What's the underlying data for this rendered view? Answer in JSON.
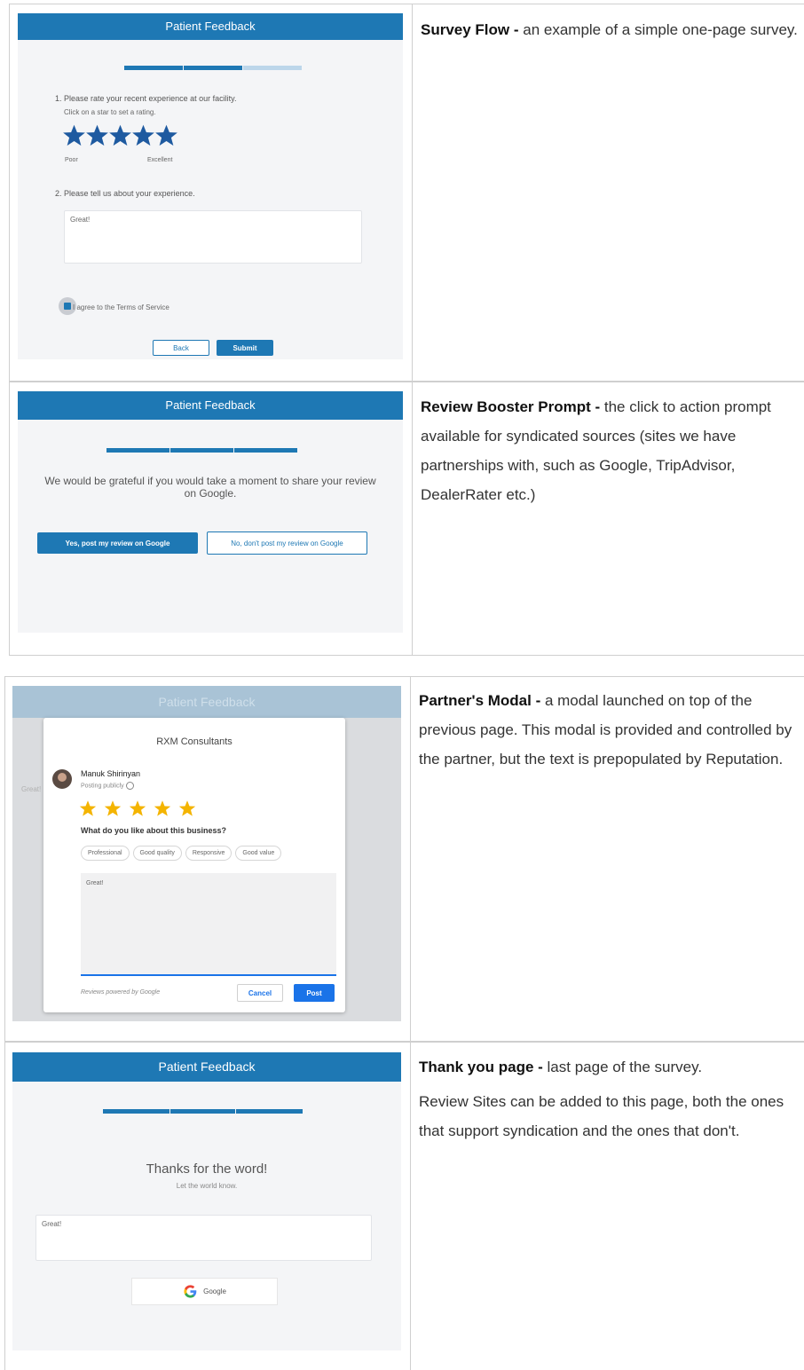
{
  "rows": [
    {
      "title": "Survey Flow - ",
      "text": "an example of a simple one-page survey.",
      "shot": {
        "header": "Patient Feedback",
        "q1": "1. Please rate your recent experience at our facility.",
        "q1_hint": "Click on a star to set a rating.",
        "rating": 5,
        "low_label": "Poor",
        "high_label": "Excellent",
        "q2": "2. Please tell us about your experience.",
        "answer": "Great!",
        "terms": "I agree to the Terms of Service",
        "back": "Back",
        "submit": "Submit"
      }
    },
    {
      "title": "Review Booster Prompt - ",
      "text": "the click to action prompt available for syndicated sources (sites we have partnerships with, such as Google, TripAdvisor, DealerRater etc.)",
      "shot": {
        "header": "Patient Feedback",
        "message": "We would be grateful if you would take a moment to share your review on Google.",
        "yes": "Yes, post my review on Google",
        "no": "No, don't post my review on Google"
      }
    },
    {
      "title": "Partner's Modal - ",
      "text": "a modal launched on top of the previous page. This modal is provided and controlled by the partner, but the text is prepopulated by Reputation.",
      "shot": {
        "header": "Patient Feedback",
        "behind_text": "Great!",
        "business": "RXM Consultants",
        "user": "Manuk Shirinyan",
        "posting": "Posting publicly",
        "rating": 5,
        "question": "What do you like about this business?",
        "chips": [
          "Professional",
          "Good quality",
          "Responsive",
          "Good value"
        ],
        "review": "Great!",
        "powered": "Reviews powered by Google",
        "cancel": "Cancel",
        "post": "Post"
      }
    },
    {
      "title": "Thank you page - ",
      "text": "last page of the survey.",
      "text2": "Review Sites can be added to this page, both the ones that support syndication and the ones that don't.",
      "shot": {
        "header": "Patient Feedback",
        "thanks": "Thanks for the word!",
        "sub": "Let the world know.",
        "review": "Great!",
        "site": "Google"
      }
    }
  ],
  "colors": {
    "brand": "#1e78b4",
    "star": "#1e5aa0",
    "google_star": "#f4b400",
    "google_blue": "#1a73e8"
  }
}
